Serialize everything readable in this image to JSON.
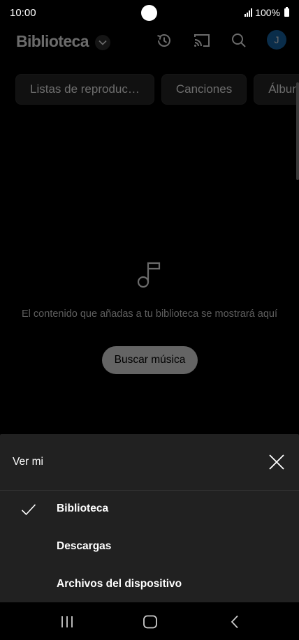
{
  "status_bar": {
    "time": "10:00",
    "battery": "100%"
  },
  "header": {
    "title": "Biblioteca",
    "dropdown_icon": "chevron-down-icon",
    "history_icon": "history-icon",
    "cast_icon": "cast-icon",
    "search_icon": "search-icon",
    "avatar_initial": "J"
  },
  "chips": [
    {
      "label": "Listas de reproduc…"
    },
    {
      "label": "Canciones"
    },
    {
      "label": "Álbum"
    }
  ],
  "empty_state": {
    "icon": "music-note-icon",
    "message": "El contenido que añadas a tu biblioteca se mostrará aquí",
    "button_label": "Buscar música"
  },
  "sheet": {
    "title": "Ver mi",
    "close_icon": "close-icon",
    "options": [
      {
        "label": "Biblioteca",
        "selected": true
      },
      {
        "label": "Descargas",
        "selected": false
      },
      {
        "label": "Archivos del dispositivo",
        "selected": false
      }
    ]
  },
  "nav_bar": {
    "recents_icon": "recents-icon",
    "home_icon": "home-icon",
    "back_icon": "back-icon"
  }
}
